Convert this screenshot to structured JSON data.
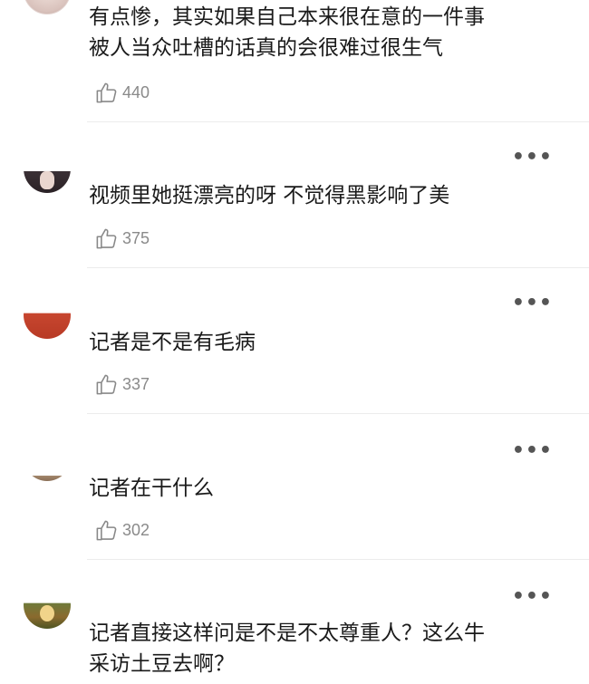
{
  "comments": [
    {
      "text": "有点惨，其实如果自己本来很在意的一件事\n被人当众吐槽的话真的会很难过很生气",
      "likes": "440"
    },
    {
      "text": "视频里她挺漂亮的呀 不觉得黑影响了美",
      "likes": "375"
    },
    {
      "text": "记者是不是有毛病",
      "likes": "337"
    },
    {
      "text": "记者在干什么",
      "likes": "302"
    },
    {
      "text": "记者直接这样问是不是不太尊重人？这么牛\n采访土豆去啊？",
      "likes": ""
    }
  ],
  "icons": {
    "like": "thumbs-up-icon",
    "more": "more-dots-icon"
  },
  "colors": {
    "text": "#1a1a1a",
    "count": "#8a8a8a",
    "divider": "#ececec"
  }
}
